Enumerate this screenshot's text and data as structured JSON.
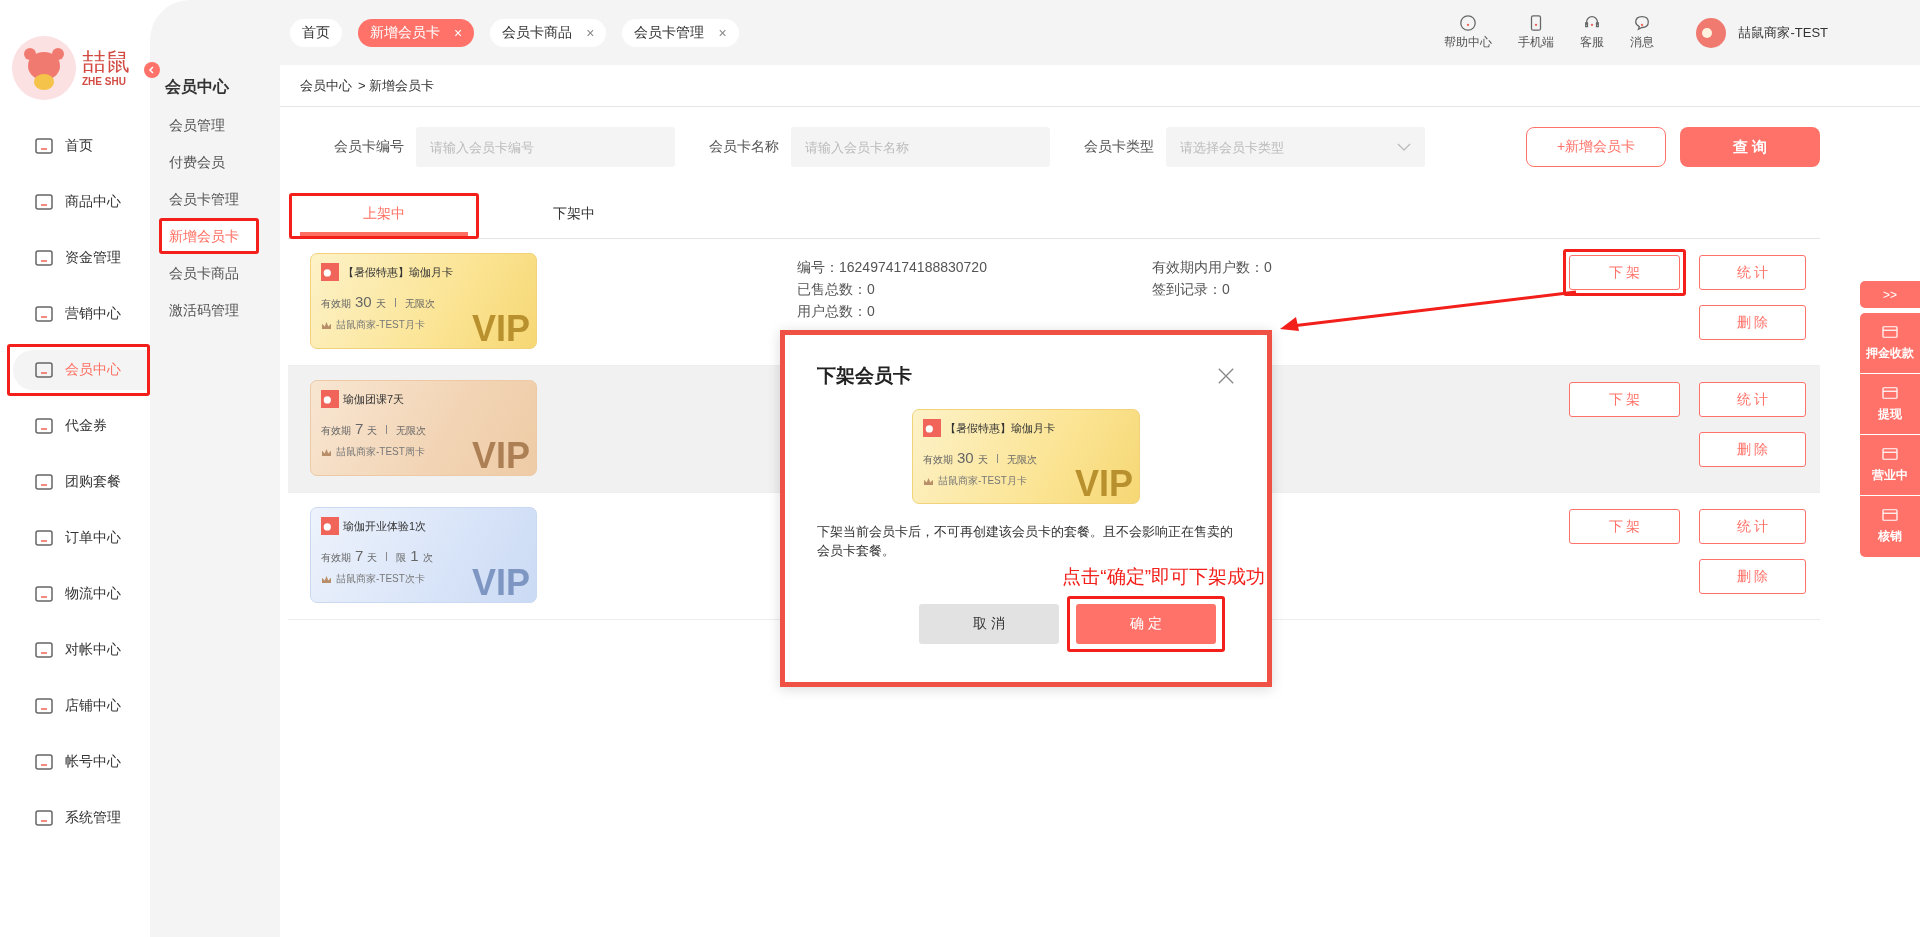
{
  "brand": {
    "name": "喆鼠",
    "sub": "ZHE SHU"
  },
  "sidebar": {
    "items": [
      {
        "label": "首页",
        "selected": false,
        "highlighted": false
      },
      {
        "label": "商品中心",
        "selected": false,
        "highlighted": false
      },
      {
        "label": "资金管理",
        "selected": false,
        "highlighted": false
      },
      {
        "label": "营销中心",
        "selected": false,
        "highlighted": false
      },
      {
        "label": "会员中心",
        "selected": true,
        "highlighted": true
      },
      {
        "label": "代金券",
        "selected": false,
        "highlighted": false
      },
      {
        "label": "团购套餐",
        "selected": false,
        "highlighted": false
      },
      {
        "label": "订单中心",
        "selected": false,
        "highlighted": false
      },
      {
        "label": "物流中心",
        "selected": false,
        "highlighted": false
      },
      {
        "label": "对帐中心",
        "selected": false,
        "highlighted": false
      },
      {
        "label": "店铺中心",
        "selected": false,
        "highlighted": false
      },
      {
        "label": "帐号中心",
        "selected": false,
        "highlighted": false
      },
      {
        "label": "系统管理",
        "selected": false,
        "highlighted": false
      }
    ]
  },
  "submenu": {
    "title": "会员中心",
    "items": [
      {
        "label": "会员管理",
        "selected": false,
        "highlighted": false
      },
      {
        "label": "付费会员",
        "selected": false,
        "highlighted": false
      },
      {
        "label": "会员卡管理",
        "selected": false,
        "highlighted": false
      },
      {
        "label": "新增会员卡",
        "selected": true,
        "highlighted": true
      },
      {
        "label": "会员卡商品",
        "selected": false,
        "highlighted": false
      },
      {
        "label": "激活码管理",
        "selected": false,
        "highlighted": false
      }
    ]
  },
  "page_tabs": [
    {
      "label": "首页",
      "selected": false,
      "closable": false
    },
    {
      "label": "新增会员卡",
      "selected": true,
      "closable": true
    },
    {
      "label": "会员卡商品",
      "selected": false,
      "closable": true
    },
    {
      "label": "会员卡管理",
      "selected": false,
      "closable": true
    }
  ],
  "close_glyph": "×",
  "header_links": [
    "帮助中心",
    "手机端",
    "客服",
    "消息"
  ],
  "user": {
    "name": "喆鼠商家-TEST"
  },
  "breadcrumb": [
    "会员中心",
    "> 新增会员卡"
  ],
  "filters": [
    {
      "label": "会员卡编号",
      "placeholder": "请输入会员卡编号",
      "kind": "input"
    },
    {
      "label": "会员卡名称",
      "placeholder": "请输入会员卡名称",
      "kind": "input"
    },
    {
      "label": "会员卡类型",
      "placeholder": "请选择会员卡类型",
      "kind": "select"
    }
  ],
  "add_button": "+新增会员卡",
  "query_button": "查 询",
  "status_tabs": [
    {
      "label": "上架中",
      "selected": true,
      "highlighted": true
    },
    {
      "label": "下架中",
      "selected": false,
      "highlighted": false
    }
  ],
  "rows": [
    {
      "hovered": false,
      "card": {
        "kind": "gold",
        "title": "【暑假特惠】瑜伽月卡",
        "validity_label": "有效期",
        "days": "30",
        "day_unit": "天",
        "usage": [
          "无限次"
        ],
        "brand": "喆鼠商家-TEST月卡",
        "watermark": "VIP"
      },
      "info": [
        [
          "编号：1624974174188830720",
          "已售总数：0",
          "用户总数：0"
        ],
        [
          "有效期内用户数：0",
          "签到记录：0"
        ]
      ],
      "actions": [
        {
          "label": "下 架",
          "highlighted": true
        },
        {
          "label": "统 计",
          "highlighted": false
        },
        {
          "label": "删 除",
          "highlighted": false
        }
      ]
    },
    {
      "hovered": true,
      "card": {
        "kind": "peach",
        "title": "瑜伽团课7天",
        "validity_label": "有效期",
        "days": "7",
        "day_unit": "天",
        "usage": [
          "无限次"
        ],
        "brand": "喆鼠商家-TEST周卡",
        "watermark": "VIP"
      },
      "info": [],
      "actions": [
        {
          "label": "下 架",
          "highlighted": false
        },
        {
          "label": "统 计",
          "highlighted": false
        },
        {
          "label": "删 除",
          "highlighted": false
        }
      ]
    },
    {
      "hovered": false,
      "card": {
        "kind": "blue",
        "title": "瑜伽开业体验1次",
        "validity_label": "有效期",
        "days": "7",
        "day_unit": "天",
        "usage": [
          "限",
          "1",
          "次"
        ],
        "brand": "喆鼠商家-TEST次卡",
        "watermark": "VIP"
      },
      "info": [],
      "actions": [
        {
          "label": "下 架",
          "highlighted": false
        },
        {
          "label": "统 计",
          "highlighted": false
        },
        {
          "label": "删 除",
          "highlighted": false
        }
      ]
    }
  ],
  "float_panel": {
    "toggle": ">>",
    "items": [
      "押金收款",
      "提现",
      "营业中",
      "核销"
    ]
  },
  "dialog": {
    "title": "下架会员卡",
    "highlighted": true,
    "card": {
      "kind": "gold",
      "title": "【暑假特惠】瑜伽月卡",
      "validity_label": "有效期",
      "days": "30",
      "day_unit": "天",
      "usage": [
        "无限次"
      ],
      "brand": "喆鼠商家-TEST月卡",
      "watermark": "VIP"
    },
    "message": "下架当前会员卡后，不可再创建该会员卡的套餐。且不会影响正在售卖的会员卡套餐。",
    "note": "点击“确定”即可下架成功",
    "cancel": "取 消",
    "confirm": {
      "label": "确 定",
      "highlighted": true
    }
  }
}
